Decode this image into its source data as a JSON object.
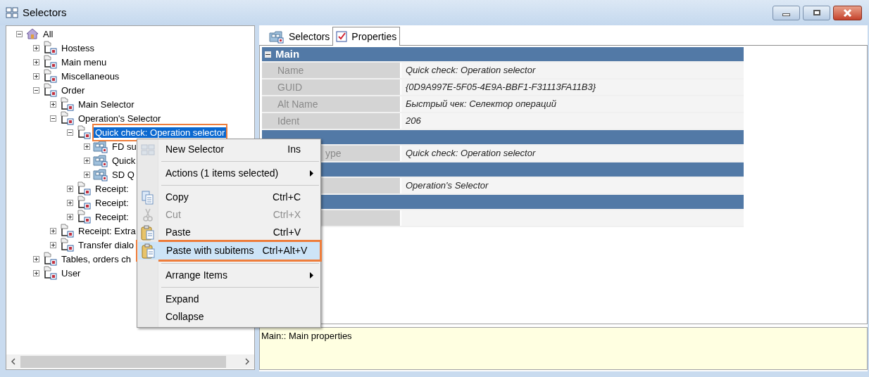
{
  "window": {
    "title": "Selectors"
  },
  "tree": [
    {
      "label": "All",
      "kind": "root",
      "expanded": true,
      "selected": false,
      "children": [
        {
          "label": "Hostess",
          "kind": "folder",
          "expanded": false,
          "selected": false
        },
        {
          "label": "Main menu",
          "kind": "folder",
          "expanded": false,
          "selected": false
        },
        {
          "label": "Miscellaneous",
          "kind": "folder",
          "expanded": false,
          "selected": false
        },
        {
          "label": "Order",
          "kind": "folder",
          "expanded": true,
          "selected": false,
          "children": [
            {
              "label": "Main Selector",
              "kind": "folder",
              "expanded": false,
              "selected": false
            },
            {
              "label": "Operation's Selector",
              "kind": "folder",
              "expanded": true,
              "selected": false,
              "children": [
                {
                  "label": "Quick check: Operation selector",
                  "kind": "folder",
                  "expanded": true,
                  "selected": true,
                  "callout": true,
                  "children": [
                    {
                      "label": "FD su",
                      "kind": "selector",
                      "expanded": false,
                      "selected": false
                    },
                    {
                      "label": "Quick",
                      "kind": "selector",
                      "expanded": false,
                      "selected": false
                    },
                    {
                      "label": "SD Q",
                      "kind": "selector",
                      "expanded": false,
                      "selected": false
                    }
                  ]
                },
                {
                  "label": "Receipt:",
                  "kind": "folder",
                  "expanded": false,
                  "selected": false
                },
                {
                  "label": "Receipt:",
                  "kind": "folder",
                  "expanded": false,
                  "selected": false
                },
                {
                  "label": "Receipt:",
                  "kind": "folder",
                  "expanded": false,
                  "selected": false
                }
              ]
            },
            {
              "label": "Receipt: Extra",
              "kind": "folder",
              "expanded": false,
              "selected": false
            },
            {
              "label": "Transfer dialo",
              "kind": "folder",
              "expanded": false,
              "selected": false
            }
          ]
        },
        {
          "label": "Tables, orders ch",
          "kind": "folder",
          "expanded": false,
          "selected": false
        },
        {
          "label": "User",
          "kind": "folder",
          "expanded": false,
          "selected": false
        }
      ]
    }
  ],
  "tabs": [
    {
      "label": "Selectors",
      "kind": "selector",
      "selected": false
    },
    {
      "label": "Properties",
      "kind": "check",
      "selected": true
    }
  ],
  "property_grid": [
    {
      "title": "Main",
      "expanded": true,
      "rows": [
        {
          "label": "Name",
          "value": "Quick check: Operation selector"
        },
        {
          "label": "GUID",
          "value": "{0D9A997E-5F05-4E9A-BBF1-F31113FA11B3}"
        },
        {
          "label": "Alt Name",
          "value": "Быстрый чек: Селектор операций"
        },
        {
          "label": "Ident",
          "value": "206"
        }
      ]
    },
    {
      "rows": [
        {
          "label": "ype",
          "value": "Quick check: Operation selector"
        }
      ]
    },
    {
      "rows": [
        {
          "value": "Operation's Selector"
        }
      ]
    },
    {
      "rows": [
        {}
      ]
    }
  ],
  "description": "Main:: Main properties",
  "context_menu": [
    {
      "kind": "new",
      "label": "New Selector",
      "shortcut": "Ins",
      "disabled": false,
      "highlighted": false
    },
    {
      "kind": "separator"
    },
    {
      "kind": "submenu",
      "label": "Actions (1 items selected)",
      "disabled": false,
      "highlighted": false
    },
    {
      "kind": "separator"
    },
    {
      "kind": "copy",
      "label": "Copy",
      "shortcut": "Ctrl+C",
      "disabled": false,
      "highlighted": false
    },
    {
      "kind": "cut",
      "label": "Cut",
      "shortcut": "Ctrl+X",
      "disabled": true,
      "highlighted": false
    },
    {
      "kind": "paste",
      "label": "Paste",
      "shortcut": "Ctrl+V",
      "disabled": false,
      "highlighted": false
    },
    {
      "kind": "paste",
      "label": "Paste with subitems",
      "shortcut": "Ctrl+Alt+V",
      "disabled": false,
      "highlighted": true,
      "callout": true
    },
    {
      "kind": "separator"
    },
    {
      "kind": "submenu",
      "label": "Arrange Items",
      "disabled": false,
      "highlighted": false
    },
    {
      "kind": "separator"
    },
    {
      "kind": "plain",
      "label": "Expand",
      "disabled": false,
      "highlighted": false
    },
    {
      "kind": "plain",
      "label": "Collapse",
      "disabled": false,
      "highlighted": false
    }
  ]
}
